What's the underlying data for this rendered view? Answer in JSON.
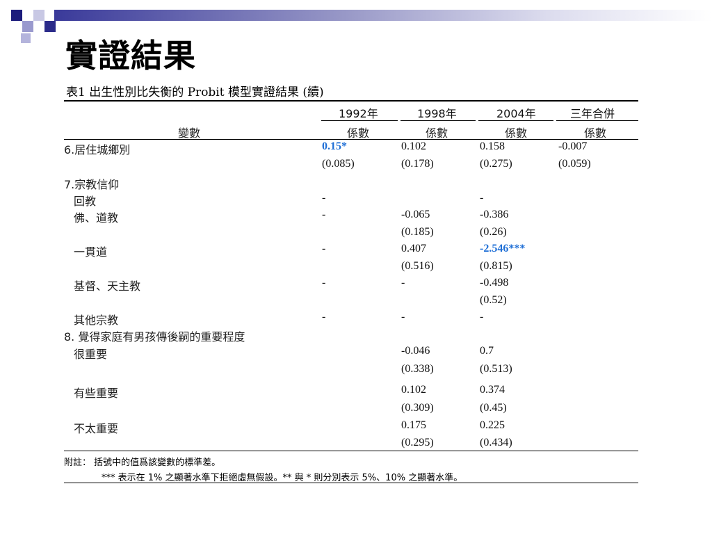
{
  "slide": {
    "title": "實證結果",
    "caption": "表1 出生性別比失衡的 Probit 模型實證結果 (續)"
  },
  "table": {
    "var_header": "變數",
    "years": [
      "1992年",
      "1998年",
      "2004年",
      "三年合併"
    ],
    "coef_label": "係數",
    "rows": [
      {
        "label": "6.居住城鄉別",
        "vals": [
          "0.15*",
          "0.102",
          "0.158",
          "-0.007"
        ]
      },
      {
        "label": "",
        "vals": [
          "(0.085)",
          "(0.178)",
          "(0.275)",
          "(0.059)"
        ]
      },
      {
        "label": "7.宗教信仰",
        "vals": [
          "",
          "",
          "",
          ""
        ]
      },
      {
        "label": "回教",
        "vals": [
          "-",
          "",
          "-",
          ""
        ]
      },
      {
        "label": "佛、道教",
        "vals": [
          "-",
          "-0.065",
          "-0.386",
          ""
        ]
      },
      {
        "label": "",
        "vals": [
          "",
          "(0.185)",
          "(0.26)",
          ""
        ]
      },
      {
        "label": "一貫道",
        "vals": [
          "-",
          "0.407",
          "-2.546***",
          ""
        ]
      },
      {
        "label": "",
        "vals": [
          "",
          "(0.516)",
          "(0.815)",
          ""
        ]
      },
      {
        "label": "基督、天主教",
        "vals": [
          "-",
          "-",
          "-0.498",
          ""
        ]
      },
      {
        "label": "",
        "vals": [
          "",
          "",
          "(0.52)",
          ""
        ]
      },
      {
        "label": "其他宗教",
        "vals": [
          "-",
          "-",
          "-",
          ""
        ]
      },
      {
        "label": "8. 覺得家庭有男孩傳後嗣的重要程度",
        "vals": [
          "",
          "",
          "",
          ""
        ]
      },
      {
        "label": "很重要",
        "vals": [
          "",
          "-0.046",
          "0.7",
          ""
        ]
      },
      {
        "label": "",
        "vals": [
          "",
          "(0.338)",
          "(0.513)",
          ""
        ]
      },
      {
        "label": "有些重要",
        "vals": [
          "",
          "0.102",
          "0.374",
          ""
        ]
      },
      {
        "label": "",
        "vals": [
          "",
          "(0.309)",
          "(0.45)",
          ""
        ]
      },
      {
        "label": "不太重要",
        "vals": [
          "",
          "0.175",
          "0.225",
          ""
        ]
      },
      {
        "label": "",
        "vals": [
          "",
          "(0.295)",
          "(0.434)",
          ""
        ]
      }
    ]
  },
  "notes": {
    "line1": "附註： 括號中的值爲該變數的標準差。",
    "line2": "*** 表示在 1% 之顯著水準下拒絕虛無假設。** 與 * 則分別表示 5%、10% 之顯著水準。"
  },
  "colors": {
    "highlight": "#1f6fd6",
    "header_dark": "#1c1c7c",
    "header_light": "#9a9ace"
  }
}
